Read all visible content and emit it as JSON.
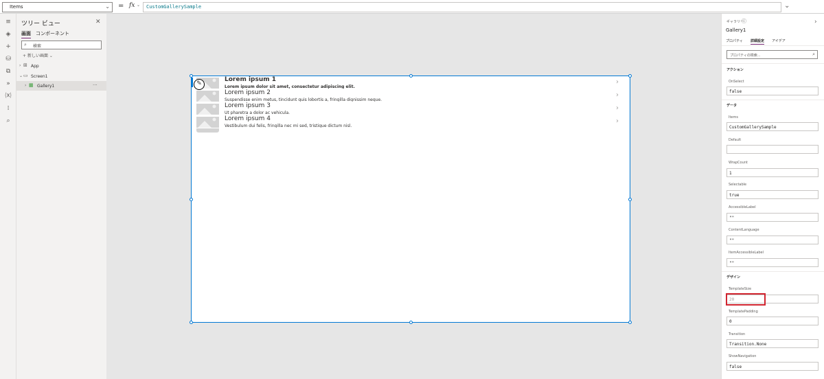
{
  "formula_bar": {
    "property": "Items",
    "equals": "=",
    "fx": "fx",
    "formula": "CustomGallerySample"
  },
  "tree_view": {
    "title": "ツリー ビュー",
    "tabs": [
      "画面",
      "コンポーネント"
    ],
    "search_placeholder": "検索",
    "new_screen": "新しい画面",
    "items": [
      {
        "label": "App"
      },
      {
        "label": "Screen1"
      },
      {
        "label": "Gallery1"
      }
    ]
  },
  "gallery": {
    "items": [
      {
        "title": "Lorem ipsum 1",
        "subtitle": "Lorem ipsum dolor sit amet, consectetur adipiscing elit."
      },
      {
        "title": "Lorem ipsum 2",
        "subtitle": "Suspendisse enim metus, tincidunt quis lobortis a, fringilla dignissim neque."
      },
      {
        "title": "Lorem ipsum 3",
        "subtitle": "Ut pharetra a dolor ac vehicula."
      },
      {
        "title": "Lorem ipsum 4",
        "subtitle": "Vestibulum dui felis, fringilla nec mi sed, tristique dictum nisl."
      }
    ]
  },
  "properties": {
    "control_type": "ギャラリー",
    "control_name": "Gallery1",
    "tabs": [
      "プロパティ",
      "詳細設定",
      "アイデア"
    ],
    "search_placeholder": "プロパティの検索...",
    "sections": {
      "action": "アクション",
      "data": "データ",
      "design": "デザイン"
    },
    "fields": {
      "onselect": {
        "label": "OnSelect",
        "value": "false"
      },
      "items": {
        "label": "Items",
        "value": "CustomGallerySample"
      },
      "default": {
        "label": "Default",
        "value": ""
      },
      "wrapcount": {
        "label": "WrapCount",
        "value": "1"
      },
      "selectable": {
        "label": "Selectable",
        "value": "true"
      },
      "accessiblelabel": {
        "label": "AccessibleLabel",
        "value": "\"\""
      },
      "contentlanguage": {
        "label": "ContentLanguage",
        "value": "\"\""
      },
      "itemaccessiblelabel": {
        "label": "ItemAccessibleLabel",
        "value": "\"\""
      },
      "templatesize": {
        "label": "TemplateSize",
        "value": "20"
      },
      "templatepadding": {
        "label": "TemplatePadding",
        "value": "0"
      },
      "transition": {
        "label": "Transition",
        "value": "Transition.None"
      },
      "shownavigation": {
        "label": "ShowNavigation",
        "value": "false"
      }
    }
  },
  "colors": {
    "accent": "#742774",
    "selection": "#0078d4",
    "highlight": "#d1242f"
  }
}
